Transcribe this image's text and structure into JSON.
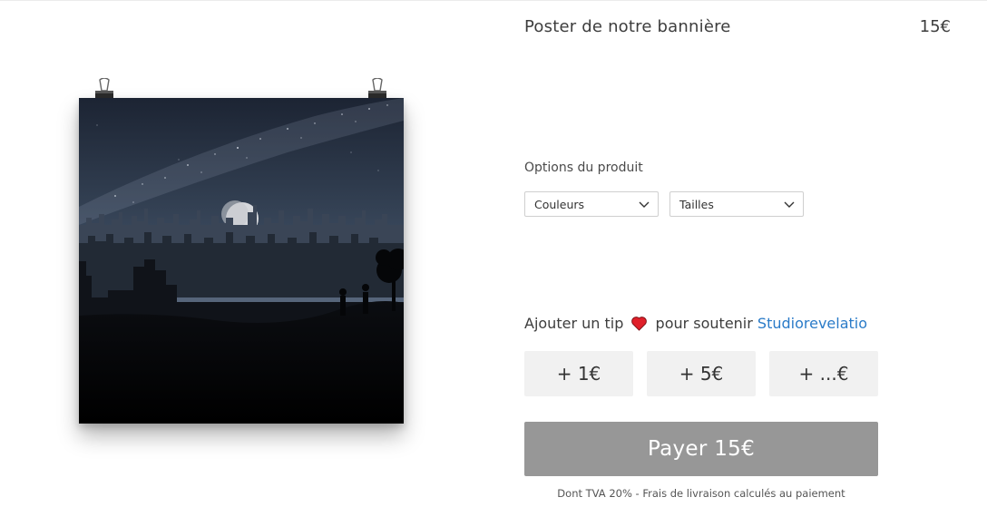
{
  "product": {
    "title": "Poster de notre bannière",
    "price": "15€",
    "image_alt": "poster-night-city"
  },
  "options": {
    "label": "Options du produit",
    "colors_select": {
      "selected": "Couleurs"
    },
    "sizes_select": {
      "selected": "Tailles"
    }
  },
  "tip": {
    "prefix": "Ajouter un tip",
    "middle": "pour soutenir",
    "creator": "Studiorevelatio",
    "heart_color": "#e0202a",
    "buttons": [
      "+ 1€",
      "+ 5€",
      "+ ...€"
    ]
  },
  "checkout": {
    "pay_label": "Payer 15€",
    "button_color": "#979797",
    "note": "Dont TVA 20% - Frais de livraison calculés au paiement"
  },
  "colors": {
    "link": "#2a7bc8",
    "tip_button_bg": "#f1f1f1"
  }
}
